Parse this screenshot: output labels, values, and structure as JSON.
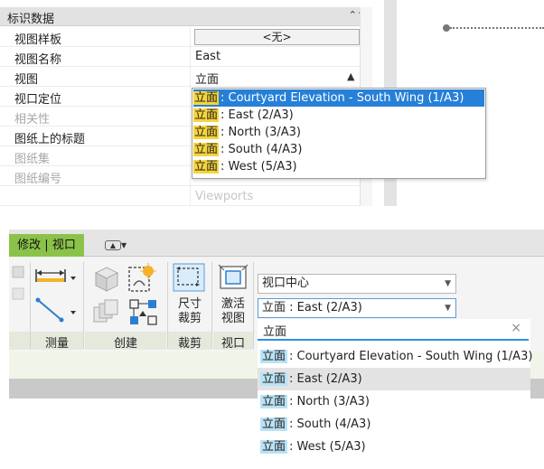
{
  "properties": {
    "section_title": "标识数据",
    "collapse_icon": "double-chevron-up-icon",
    "rows": [
      {
        "label": "视图样板",
        "value": "<无>"
      },
      {
        "label": "视图名称",
        "value": "East"
      },
      {
        "label": "视图",
        "value": "立面"
      },
      {
        "label": "视口定位",
        "value": ""
      },
      {
        "label": "相关性",
        "value": ""
      },
      {
        "label": "图纸上的标题",
        "value": ""
      },
      {
        "label": "图纸集",
        "value": ""
      },
      {
        "label": "图纸编号",
        "value": ""
      },
      {
        "label": "",
        "value": ""
      }
    ],
    "watermark": "Viewports",
    "dropdown": {
      "highlight_color": "#f6d53a",
      "selected_color": "#2680d8",
      "items": [
        {
          "prefix": "立面",
          "rest": ": Courtyard Elevation - South Wing (1/A3)",
          "selected": true
        },
        {
          "prefix": "立面",
          "rest": ": East (2/A3)",
          "selected": false
        },
        {
          "prefix": "立面",
          "rest": ": North (3/A3)",
          "selected": false
        },
        {
          "prefix": "立面",
          "rest": ": South (4/A3)",
          "selected": false
        },
        {
          "prefix": "立面",
          "rest": ": West (5/A3)",
          "selected": false
        }
      ]
    }
  },
  "ribbon": {
    "tab_label": "修改 | 视口",
    "tab_color": "#8bc34a",
    "groups": [
      {
        "name": "测量"
      },
      {
        "name": "创建"
      },
      {
        "name": "裁剪"
      },
      {
        "name": "视口"
      }
    ],
    "tools": {
      "crop_size": "尺寸\n裁剪",
      "activate_view": "激活\n视图"
    },
    "combo_position": {
      "value": "视口中心"
    },
    "combo_view": {
      "value": "立面 : East (2/A3)"
    },
    "search": {
      "value": "立面"
    },
    "dropdown": {
      "highlight_color": "#b9e3f5",
      "items": [
        {
          "prefix": "立面",
          "rest": ": Courtyard Elevation - South Wing (1/A3)"
        },
        {
          "prefix": "立面",
          "rest": ": East (2/A3)",
          "hover": true
        },
        {
          "prefix": "立面",
          "rest": ": North (3/A3)"
        },
        {
          "prefix": "立面",
          "rest": ": South (4/A3)"
        },
        {
          "prefix": "立面",
          "rest": ": West (5/A3)"
        }
      ]
    }
  }
}
